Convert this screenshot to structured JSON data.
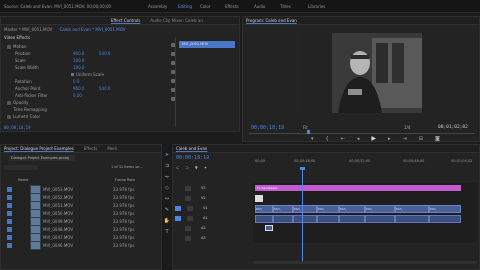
{
  "workspace": {
    "tabs": [
      "Assembly",
      "Editing",
      "Color",
      "Effects",
      "Audio",
      "Titles",
      "Libraries"
    ],
    "active_index": 1,
    "source_title": "Source: Caleb and Evan: MVI_0051.MOV: 00;00;00;00"
  },
  "effect_controls": {
    "tabs": [
      "Effect Controls",
      "Audio Clip Mixer: Caleb an"
    ],
    "breadcrumb_master": "Master * MVI_0051.MOV",
    "breadcrumb_seq": "Caleb and Evan * MVI_0051.MOV",
    "section_label": "Video Effects",
    "clip_badge": "MVI_0051.MOV",
    "rows": [
      {
        "name": "Motion",
        "value": "",
        "value2": ""
      },
      {
        "name": "Position",
        "value": "960.0",
        "value2": "540.0"
      },
      {
        "name": "Scale",
        "value": "100.0",
        "value2": ""
      },
      {
        "name": "Scale Width",
        "value": "100.0",
        "value2": ""
      },
      {
        "name": "Uniform Scale",
        "value": "",
        "value2": ""
      },
      {
        "name": "Rotation",
        "value": "0.0",
        "value2": ""
      },
      {
        "name": "Anchor Point",
        "value": "960.0",
        "value2": "540.0"
      },
      {
        "name": "Anti-flicker Filter",
        "value": "0.00",
        "value2": ""
      },
      {
        "name": "Opacity",
        "value": "",
        "value2": ""
      },
      {
        "name": "Time Remapping",
        "value": "",
        "value2": ""
      },
      {
        "name": "Lumetri Color",
        "value": "",
        "value2": ""
      }
    ],
    "timecode": "00;00;18;19"
  },
  "program": {
    "title": "Program: Caleb and Evan",
    "timecode_left": "00;00;18;19",
    "fit": "Fit",
    "fraction": "1/4",
    "timecode_right": "00;01;02;02"
  },
  "project": {
    "tabs": [
      "Project: Dialogue Project Examples",
      "Effects",
      "Medi"
    ],
    "file_name": "Dialogue Project Examples.prproj",
    "items_info": "1 of 31 items se...",
    "col_name": "Name",
    "col_rate": "Frame Rate",
    "items": [
      {
        "name": "MVI_0053.MOV",
        "rate": "23.976 fps"
      },
      {
        "name": "MVI_0052.MOV",
        "rate": "23.976 fps"
      },
      {
        "name": "MVI_0051.MOV",
        "rate": "23.976 fps"
      },
      {
        "name": "MVI_0050.MOV",
        "rate": "23.976 fps"
      },
      {
        "name": "MVI_0049.MOV",
        "rate": "23.976 fps"
      },
      {
        "name": "MVI_0048.MOV",
        "rate": "23.976 fps"
      },
      {
        "name": "MVI_0047.MOV",
        "rate": "23.976 fps"
      },
      {
        "name": "MVI_0046.MOV",
        "rate": "23.976 fps"
      }
    ]
  },
  "timeline": {
    "title": "Caleb and Evan",
    "timecode": "00:00:18:19",
    "ruler": [
      "00;00",
      "00;00;16;00",
      "00;00;32;00",
      "00;00;48;00",
      "00;01;04;02"
    ],
    "tracks": [
      "V3",
      "V2",
      "V1",
      "A1",
      "A2",
      "A3"
    ],
    "pink_clip_label": "Fx Sandpaper",
    "clip_label": "MVI_"
  },
  "colors": {
    "accent_blue": "#4b86e2",
    "playhead": "#4b86e2",
    "pink_clip": "#c25ad0"
  }
}
